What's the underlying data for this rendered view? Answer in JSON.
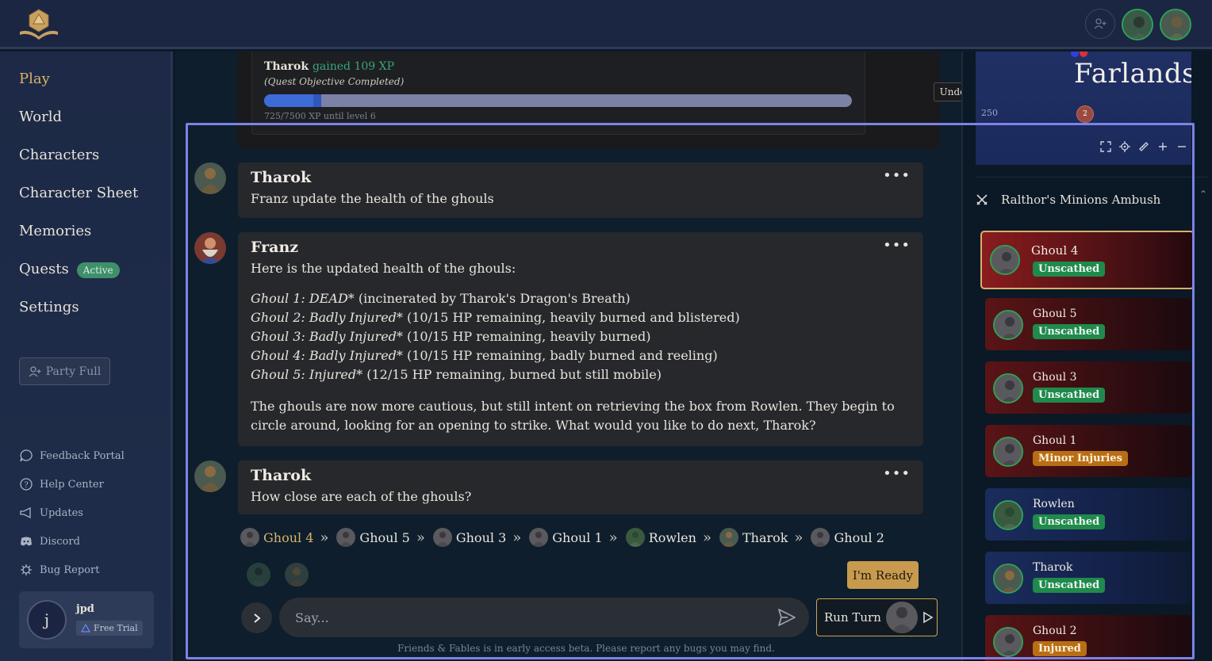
{
  "nav": {
    "items": [
      {
        "label": "Play",
        "active": true
      },
      {
        "label": "World"
      },
      {
        "label": "Characters"
      },
      {
        "label": "Character Sheet"
      },
      {
        "label": "Memories"
      },
      {
        "label": "Quests",
        "badge": "Active"
      },
      {
        "label": "Settings"
      }
    ],
    "party_button": "Party Full"
  },
  "links": [
    {
      "label": "Feedback Portal",
      "icon": "chat-bubble-icon"
    },
    {
      "label": "Help Center",
      "icon": "help-circle-icon"
    },
    {
      "label": "Updates",
      "icon": "megaphone-icon"
    },
    {
      "label": "Discord",
      "icon": "discord-icon"
    },
    {
      "label": "Bug Report",
      "icon": "bug-icon"
    }
  ],
  "user": {
    "initial": "j",
    "name": "jpd",
    "plan": "Free Trial"
  },
  "xp": {
    "name": "Tharok",
    "gain": "gained 109 XP",
    "reason": "(Quest Objective Completed)",
    "progress_current": 725,
    "progress_total": 7500,
    "until": "725/7500 XP until level 6",
    "undo": "Undo"
  },
  "messages": {
    "m1": {
      "name": "Tharok",
      "text": "Franz update the health of the ghouls"
    },
    "m2": {
      "name": "Franz",
      "intro": "Here is the updated health of the ghouls:",
      "lines": [
        {
          "em": "Ghoul 1: DEAD",
          "rest": "* (incinerated by Tharok's Dragon's Breath)"
        },
        {
          "em": "Ghoul 2: Badly Injured",
          "rest": "* (10/15 HP remaining, heavily burned and blistered)"
        },
        {
          "em": "Ghoul 3: Badly Injured",
          "rest": "* (10/15 HP remaining, heavily burned)"
        },
        {
          "em": "Ghoul 4: Badly Injured",
          "rest": "* (10/15 HP remaining, badly burned and reeling)"
        },
        {
          "em": "Ghoul 5: Injured",
          "rest": "* (12/15 HP remaining, burned but still mobile)"
        }
      ],
      "outro": "The ghouls are now more cautious, but still intent on retrieving the box from Rowlen. They begin to circle around, looking for an opening to strike. What would you like to do next, Tharok?"
    },
    "m3": {
      "name": "Tharok",
      "text": "How close are each of the ghouls?"
    },
    "more": "•••"
  },
  "turn_order": [
    "Ghoul 4",
    "Ghoul 5",
    "Ghoul 3",
    "Ghoul 1",
    "Rowlen",
    "Tharok",
    "Ghoul 2"
  ],
  "turn_sep": "»",
  "ready_button": "I'm Ready",
  "input": {
    "placeholder": "Say..."
  },
  "run_turn": "Run Turn",
  "footer": "Friends & Fables is in early access beta. Please report any bugs you may find.",
  "map": {
    "title": "Farlands",
    "scale": "250",
    "marker": "2"
  },
  "encounter": {
    "title": "Ralthor's Minions Ambush"
  },
  "combatants": [
    {
      "name": "Ghoul 4",
      "status": "Unscathed",
      "status_color": "green",
      "side": "enemy",
      "current": true
    },
    {
      "name": "Ghoul 5",
      "status": "Unscathed",
      "status_color": "green",
      "side": "enemy"
    },
    {
      "name": "Ghoul 3",
      "status": "Unscathed",
      "status_color": "green",
      "side": "enemy"
    },
    {
      "name": "Ghoul 1",
      "status": "Minor Injuries",
      "status_color": "orange",
      "side": "enemy"
    },
    {
      "name": "Rowlen",
      "status": "Unscathed",
      "status_color": "green",
      "side": "ally"
    },
    {
      "name": "Tharok",
      "status": "Unscathed",
      "status_color": "green",
      "side": "ally"
    },
    {
      "name": "Ghoul 2",
      "status": "Injured",
      "status_color": "orange",
      "side": "enemy"
    }
  ],
  "colors": {
    "accent_gold": "#d9b36c",
    "status_green": "#1f8a4c",
    "status_orange": "#b86e14",
    "xp_blue": "#3d6bd8"
  }
}
